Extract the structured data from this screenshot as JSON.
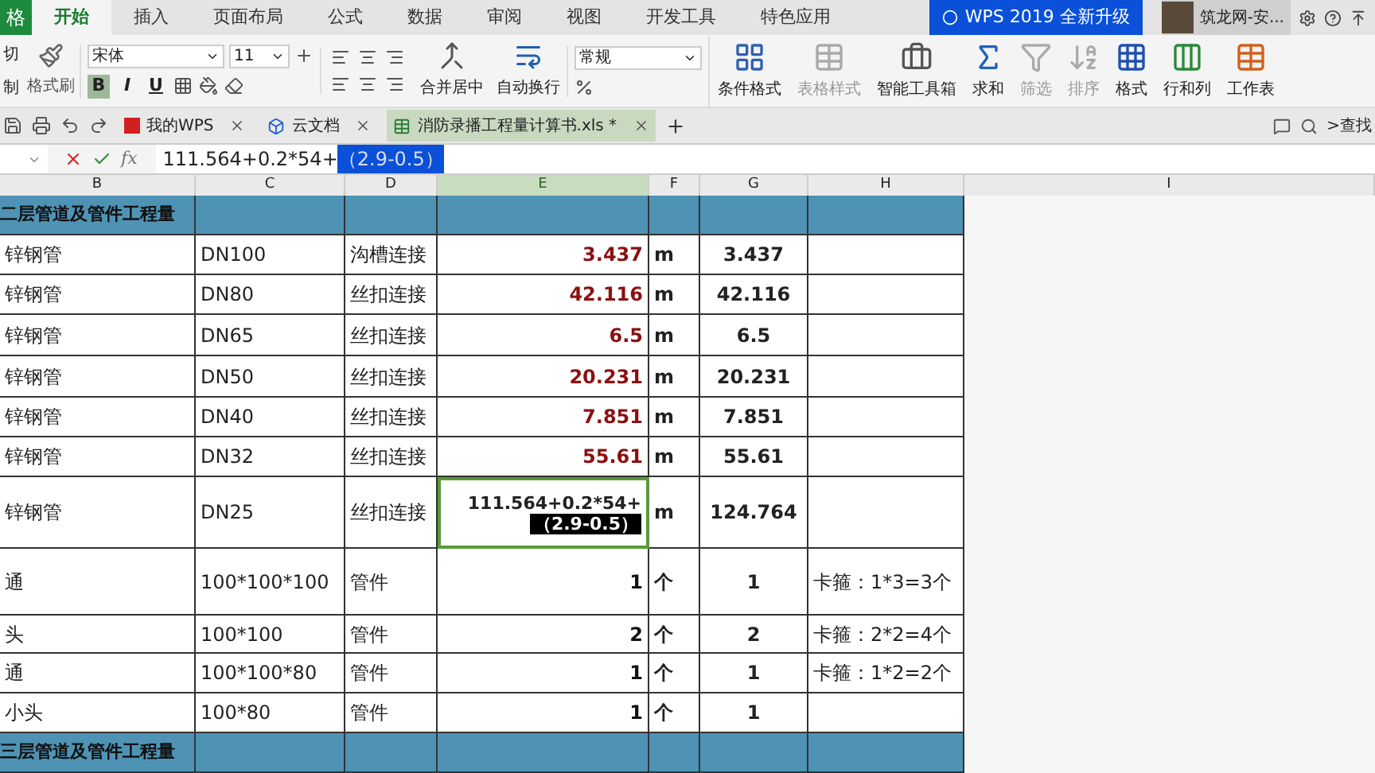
{
  "menu_tabs": [
    {
      "label": "格",
      "selected": false,
      "kind": "app"
    },
    {
      "label": "开始",
      "selected": true,
      "kind": "tab"
    },
    {
      "label": "插入",
      "selected": false,
      "kind": "tab"
    },
    {
      "label": "页面布局",
      "selected": false,
      "kind": "tab"
    },
    {
      "label": "公式",
      "selected": false,
      "kind": "tab"
    },
    {
      "label": "数据",
      "selected": false,
      "kind": "tab"
    },
    {
      "label": "审阅",
      "selected": false,
      "kind": "tab"
    },
    {
      "label": "视图",
      "selected": false,
      "kind": "tab"
    },
    {
      "label": "开发工具",
      "selected": false,
      "kind": "tab"
    },
    {
      "label": "特色应用",
      "selected": false,
      "kind": "tab"
    }
  ],
  "wps_banner": "WPS 2019 全新升级",
  "account": "筑龙网-安...",
  "ribbon": {
    "cut": "切",
    "copy": "制",
    "format_painter": "格式刷",
    "font": "宋体",
    "font_size": "11",
    "format_buttons": [
      {
        "label": "B",
        "selected": true
      },
      {
        "label": "I",
        "selected": false
      },
      {
        "label": "U",
        "selected": false
      }
    ],
    "merge": "合并居中",
    "wrap": "自动换行",
    "number_format": "常规",
    "big_buttons": [
      {
        "label": "条件格式",
        "kind": "conditional",
        "disabled": false
      },
      {
        "label": "表格样式",
        "kind": "style",
        "disabled": true
      },
      {
        "label": "智能工具箱",
        "kind": "toolbox",
        "disabled": false
      },
      {
        "label": "求和",
        "kind": "sum",
        "disabled": false
      },
      {
        "label": "筛选",
        "kind": "filter",
        "disabled": true
      },
      {
        "label": "排序",
        "kind": "sort",
        "disabled": true
      },
      {
        "label": "格式",
        "kind": "format",
        "disabled": false
      },
      {
        "label": "行和列",
        "kind": "rows",
        "disabled": false
      },
      {
        "label": "工作表",
        "kind": "sheet",
        "disabled": false
      }
    ]
  },
  "doc_tabs": [
    {
      "label": "我的WPS",
      "kind": "wps",
      "selected": false
    },
    {
      "label": "云文档",
      "kind": "cloud",
      "selected": false
    },
    {
      "label": "消防录播工程量计算书.xls *",
      "kind": "sheet",
      "selected": true
    }
  ],
  "search": ">查找",
  "formula_bar": {
    "fx": "fx",
    "formula": "111.564+0.2*54+",
    "formula_selected": "（2.9-0.5）"
  },
  "columns": [
    {
      "label": "B",
      "selected": false
    },
    {
      "label": "C",
      "selected": false
    },
    {
      "label": "D",
      "selected": false
    },
    {
      "label": "E",
      "selected": true
    },
    {
      "label": "F",
      "selected": false
    },
    {
      "label": "G",
      "selected": false
    },
    {
      "label": "H",
      "selected": false
    },
    {
      "label": "I",
      "selected": false
    }
  ],
  "rows": [
    {
      "kind": "section",
      "b": "二层管道及管件工程量"
    },
    {
      "kind": "pipe",
      "b": "锌钢管",
      "c": "DN100",
      "d": "沟槽连接",
      "e": "3.437",
      "f": "m",
      "g": "3.437"
    },
    {
      "kind": "pipe",
      "b": "锌钢管",
      "c": "DN80",
      "d": "丝扣连接",
      "e": "42.116",
      "f": "m",
      "g": "42.116"
    },
    {
      "kind": "pipe",
      "b": "锌钢管",
      "c": "DN65",
      "d": "丝扣连接",
      "e": "6.5",
      "f": "m",
      "g": "6.5"
    },
    {
      "kind": "pipe",
      "b": "锌钢管",
      "c": "DN50",
      "d": "丝扣连接",
      "e": "20.231",
      "f": "m",
      "g": "20.231"
    },
    {
      "kind": "pipe",
      "b": "锌钢管",
      "c": "DN40",
      "d": "丝扣连接",
      "e": "7.851",
      "f": "m",
      "g": "7.851"
    },
    {
      "kind": "pipe",
      "b": "锌钢管",
      "c": "DN32",
      "d": "丝扣连接",
      "e": "55.61",
      "f": "m",
      "g": "55.61"
    },
    {
      "kind": "editing",
      "b": "锌钢管",
      "c": "DN25",
      "d": "丝扣连接",
      "e": "111.564+0.2*54+",
      "e_selected": "（2.9-0.5）",
      "f": "m",
      "g": "124.764"
    },
    {
      "kind": "fitting",
      "b": "通",
      "c": "100*100*100",
      "d": "管件",
      "e": "1",
      "f": "个",
      "g": "1",
      "h": "卡箍：1*3=3个"
    },
    {
      "kind": "fitting",
      "b": "头",
      "c": "100*100",
      "d": "管件",
      "e": "2",
      "f": "个",
      "g": "2",
      "h": "卡箍：2*2=4个"
    },
    {
      "kind": "fitting",
      "b": "通",
      "c": "100*100*80",
      "d": "管件",
      "e": "1",
      "f": "个",
      "g": "1",
      "h": "卡箍：1*2=2个"
    },
    {
      "kind": "fitting",
      "b": "小头",
      "c": "100*80",
      "d": "管件",
      "e": "1",
      "f": "个",
      "g": "1"
    },
    {
      "kind": "section",
      "b": "三层管道及管件工程量"
    }
  ]
}
